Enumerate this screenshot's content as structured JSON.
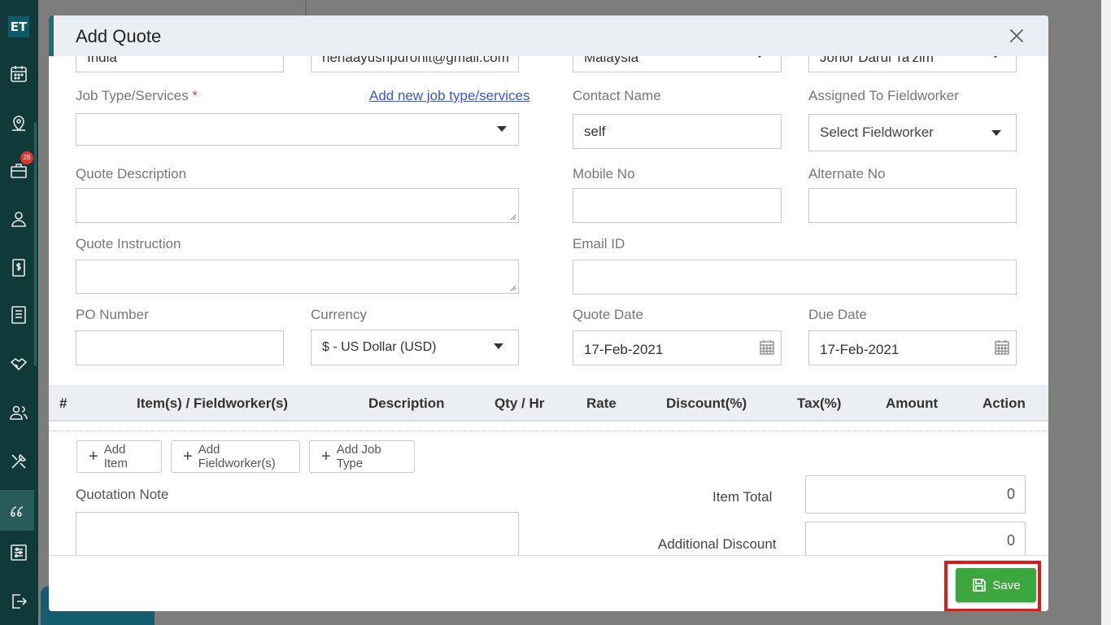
{
  "sidebar": {
    "logo": "ET",
    "badge_count": "28"
  },
  "modal": {
    "title": "Add Quote",
    "top_row": {
      "country": "India",
      "email_top": "nehaayushpurohit@gmail.com",
      "country_select": "Malaysia",
      "state_select": "Johor Darul Ta'zim"
    },
    "job_type": {
      "label": "Job Type/Services",
      "required": "*",
      "link": "Add new job type/services",
      "value": ""
    },
    "contact_name": {
      "label": "Contact Name",
      "value": "self"
    },
    "assigned_to": {
      "label": "Assigned To Fieldworker",
      "placeholder": "Select Fieldworker"
    },
    "quote_description": {
      "label": "Quote Description"
    },
    "mobile_no": {
      "label": "Mobile No"
    },
    "alternate_no": {
      "label": "Alternate No"
    },
    "quote_instruction": {
      "label": "Quote Instruction"
    },
    "email_id": {
      "label": "Email ID"
    },
    "po_number": {
      "label": "PO Number"
    },
    "currency": {
      "label": "Currency",
      "value": "$ - US Dollar (USD)"
    },
    "quote_date": {
      "label": "Quote Date",
      "value": "17-Feb-2021"
    },
    "due_date": {
      "label": "Due Date",
      "value": "17-Feb-2021"
    },
    "table": {
      "columns": [
        "#",
        "Item(s) / Fieldworker(s)",
        "Description",
        "Qty / Hr",
        "Rate",
        "Discount(%)",
        "Tax(%)",
        "Amount",
        "Action"
      ]
    },
    "buttons": {
      "add_item": "Add Item",
      "add_fieldworker": "Add Fieldworker(s)",
      "add_job_type": "Add Job Type",
      "save": "Save"
    },
    "quotation_note": {
      "label": "Quotation Note"
    },
    "item_total": {
      "label": "Item Total",
      "value": "0"
    },
    "additional_discount": {
      "label": "Additional Discount",
      "value": "0"
    }
  },
  "colors": {
    "sidebar": "#103a3a",
    "save_button": "#3da63d",
    "highlight": "#e01818",
    "link": "#3a56d4"
  }
}
